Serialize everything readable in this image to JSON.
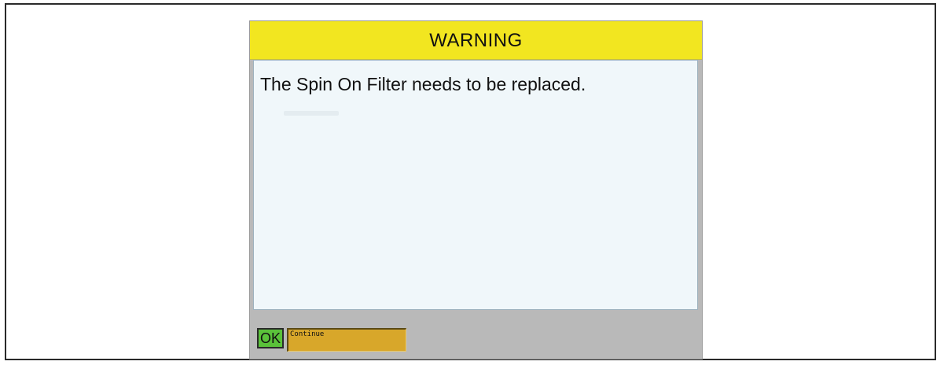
{
  "dialog": {
    "title": "WARNING",
    "message": "The Spin On Filter needs to be replaced."
  },
  "footer": {
    "ok_label": "OK",
    "continue_label": "Continue"
  },
  "colors": {
    "header": "#f2e620",
    "body": "#f0f7fa",
    "footer": "#b9b9b9",
    "ok_button": "#5ac23a",
    "continue_field": "#d8a72a"
  }
}
